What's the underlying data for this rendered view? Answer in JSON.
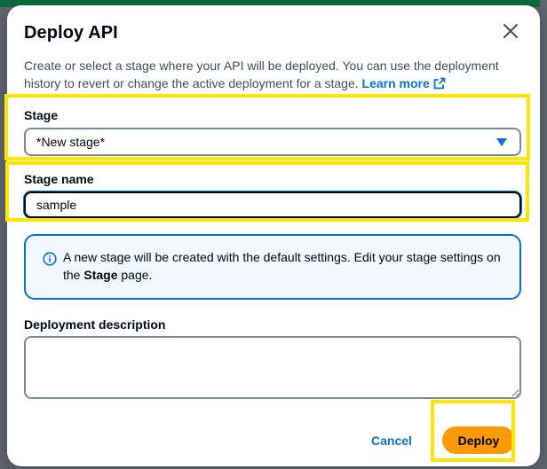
{
  "modal": {
    "title": "Deploy API",
    "description": "Create or select a stage where your API will be deployed. You can use the deployment history to revert or change the active deployment for a stage.",
    "learn_more": "Learn more"
  },
  "stage": {
    "label": "Stage",
    "selected": "*New stage*"
  },
  "stage_name": {
    "label": "Stage name",
    "value": "sample"
  },
  "alert": {
    "text_before": "A new stage will be created with the default settings. Edit your stage settings on the ",
    "text_bold": "Stage",
    "text_after": " page."
  },
  "deployment_description": {
    "label": "Deployment description",
    "value": ""
  },
  "footer": {
    "cancel_label": "Cancel",
    "deploy_label": "Deploy"
  },
  "colors": {
    "accent": "#0972d3",
    "primary_button": "#ff9900",
    "highlight": "#ffe600",
    "alert_bg": "#f2f8fd"
  },
  "icons": [
    "close-icon",
    "external-link-icon",
    "caret-down-icon",
    "info-icon"
  ]
}
